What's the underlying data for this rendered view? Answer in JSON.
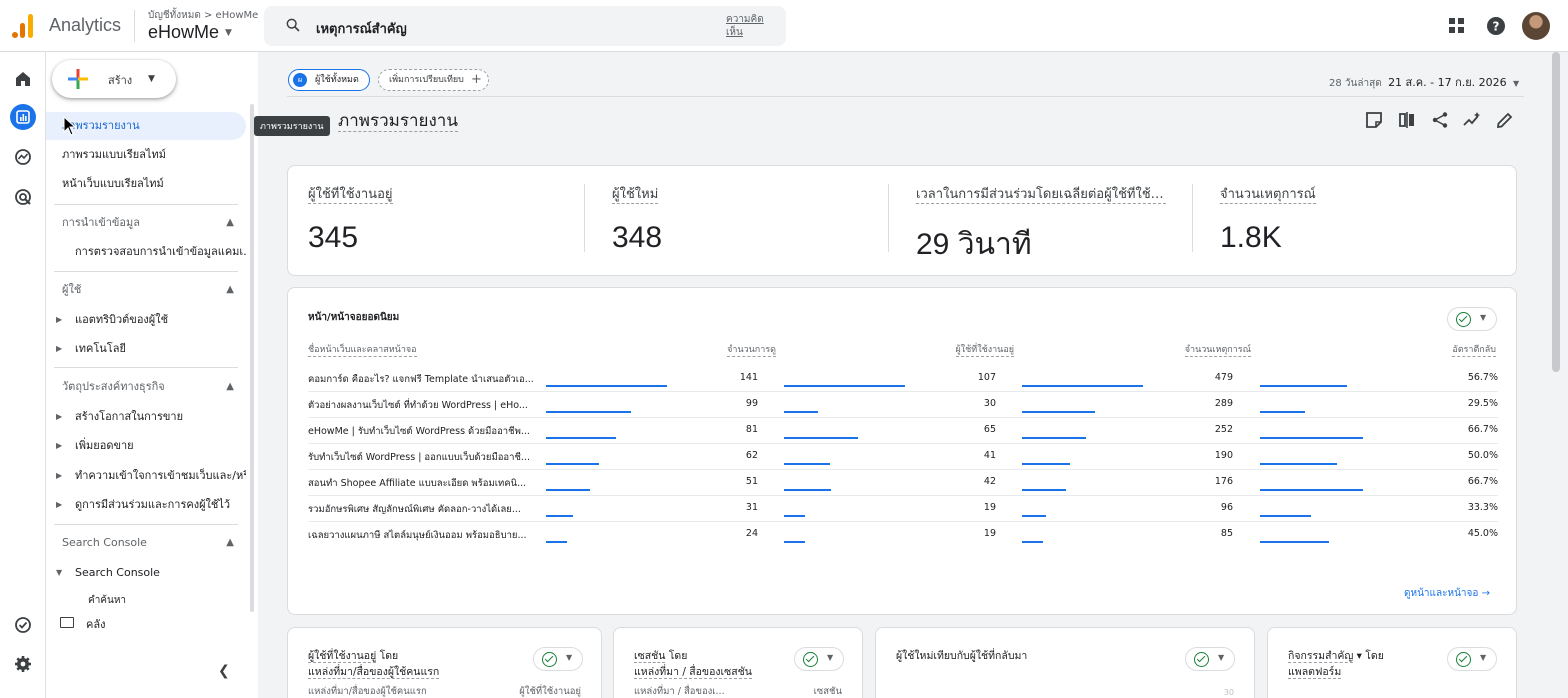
{
  "app": {
    "product": "Analytics",
    "breadcrumb": "บัญชีทั้งหมด > eHowMe",
    "account": "eHowMe",
    "search_text": "เหตุการณ์สำคัญ",
    "feedback": "ความคิดเห็น"
  },
  "nav": {
    "create_label": "สร้าง",
    "items": [
      {
        "label": "ภาพรวมรายงาน"
      },
      {
        "label": "ภาพรวมแบบเรียลไทม์"
      },
      {
        "label": "หน้าเว็บแบบเรียลไทม์"
      }
    ],
    "sections": [
      {
        "label": "การนำเข้าข้อมูล",
        "items": [
          "การตรวจสอบการนำเข้าข้อมูลแคมเ..."
        ]
      },
      {
        "label": "ผู้ใช้",
        "items": [
          "แอตทริบิวต์ของผู้ใช้",
          "เทคโนโลยี"
        ]
      },
      {
        "label": "วัตถุประสงค์ทางธุรกิจ",
        "items": [
          "สร้างโอกาสในการขาย",
          "เพิ่มยอดขาย",
          "ทำความเข้าใจการเข้าชมเว็บและ/หรื...",
          "ดูการมีส่วนร่วมและการคงผู้ใช้ไว้"
        ]
      },
      {
        "label": "Search Console",
        "items": [
          "Search Console",
          "คำค้นหา"
        ]
      }
    ],
    "library": "คลัง",
    "tooltip": "ภาพรวมรายงาน"
  },
  "main": {
    "chip_all": "ผู้ใช้ทั้งหมด",
    "chip_all_icon": "ผ",
    "chip_add": "เพิ่มการเปรียบเทียบ",
    "date_prefix": "28 วันล่าสุด",
    "date_range": "21 ส.ค. - 17 ก.ย. 2026",
    "title": "ภาพรวมรายงาน",
    "kpis": [
      {
        "label": "ผู้ใช้ที่ใช้งานอยู่",
        "value": "345"
      },
      {
        "label": "ผู้ใช้ใหม่",
        "value": "348"
      },
      {
        "label": "เวลาในการมีส่วนร่วมโดยเฉลี่ยต่อผู้ใช้ที่ใช้ง...",
        "value": "29 วินาที"
      },
      {
        "label": "จำนวนเหตุการณ์",
        "value": "1.8K"
      }
    ],
    "table": {
      "title": "หน้า/หน้าจอยอดนิยม",
      "columns": [
        "ชื่อหน้าเว็บและคลาสหน้าจอ",
        "จำนวนการดู",
        "ผู้ใช้ที่ใช้งานอยู่",
        "จำนวนเหตุการณ์",
        "อัตราตีกลับ"
      ],
      "rows": [
        {
          "name": "คอมการ์ด คืออะไร? แจกฟรี Template นำเสนอตัวเอ...",
          "views": "141",
          "users": "107",
          "events": "479",
          "bounce": "56.7%",
          "v": 141,
          "u": 107,
          "e": 479,
          "b": 0.567
        },
        {
          "name": "ตัวอย่างผลงานเว็บไซต์ ที่ทำด้วย WordPress | eHo...",
          "views": "99",
          "users": "30",
          "events": "289",
          "bounce": "29.5%",
          "v": 99,
          "u": 30,
          "e": 289,
          "b": 0.295
        },
        {
          "name": "eHowMe | รับทำเว็บไซต์ WordPress ด้วยมืออาชีพ...",
          "views": "81",
          "users": "65",
          "events": "252",
          "bounce": "66.7%",
          "v": 81,
          "u": 65,
          "e": 252,
          "b": 0.667
        },
        {
          "name": "รับทำเว็บไซต์ WordPress | ออกแบบเว็บด้วยมืออาชี...",
          "views": "62",
          "users": "41",
          "events": "190",
          "bounce": "50.0%",
          "v": 62,
          "u": 41,
          "e": 190,
          "b": 0.5
        },
        {
          "name": "สอนทำ Shopee Affiliate แบบละเอียด พร้อมเทคนิ...",
          "views": "51",
          "users": "42",
          "events": "176",
          "bounce": "66.7%",
          "v": 51,
          "u": 42,
          "e": 176,
          "b": 0.667
        },
        {
          "name": "รวมอักษรพิเศษ สัญลักษณ์พิเศษ คัดลอก-วางได้เลย...",
          "views": "31",
          "users": "19",
          "events": "96",
          "bounce": "33.3%",
          "v": 31,
          "u": 19,
          "e": 96,
          "b": 0.333
        },
        {
          "name": "เฉลยวางแผนภาษี สไตล์มนุษย์เงินออม พร้อมอธิบาย...",
          "views": "24",
          "users": "19",
          "events": "85",
          "bounce": "45.0%",
          "v": 24,
          "u": 19,
          "e": 85,
          "b": 0.45
        }
      ],
      "view_link": "ดูหน้าและหน้าจอ →"
    },
    "bottom_cards": [
      {
        "title_u": "ผู้ใช้ที่ใช้งานอยู่",
        "title_rest": " โดย",
        "line2": "แหล่งที่มา/สื่อของผู้ใช้คนแรก",
        "sub_left": "แหล่งที่มา/สื่อของผู้ใช้คนแรก",
        "sub_right": "ผู้ใช้ที่ใช้งานอยู่"
      },
      {
        "title_u": "เซสชัน",
        "title_rest": " โดย",
        "line2": "แหล่งที่มา / สื่อของเซสชัน",
        "sub_left": "แหล่งที่มา / สื่อของเ...",
        "sub_right": "เซสชัน"
      },
      {
        "title_u": "ผู้ใช้ใหม่เทียบกับผู้ใช้ที่กลับมา",
        "title_rest": "",
        "line2": "",
        "sub_left": "",
        "sub_right": "30"
      },
      {
        "title_u": "กิจกรรมสำคัญ",
        "title_rest": " ▾ โดย",
        "line2": "แพลตฟอร์ม",
        "sub_left": "",
        "sub_right": ""
      }
    ]
  },
  "colors": {
    "accent": "#1a73e8",
    "success": "#188038",
    "logo_orange": "#e37400",
    "logo_yellow": "#f9ab00"
  },
  "icons": [
    "search-icon",
    "apps-icon",
    "help-icon",
    "home-icon",
    "reports-icon",
    "explore-icon",
    "advertising-icon",
    "admin-icon",
    "settings-icon"
  ]
}
